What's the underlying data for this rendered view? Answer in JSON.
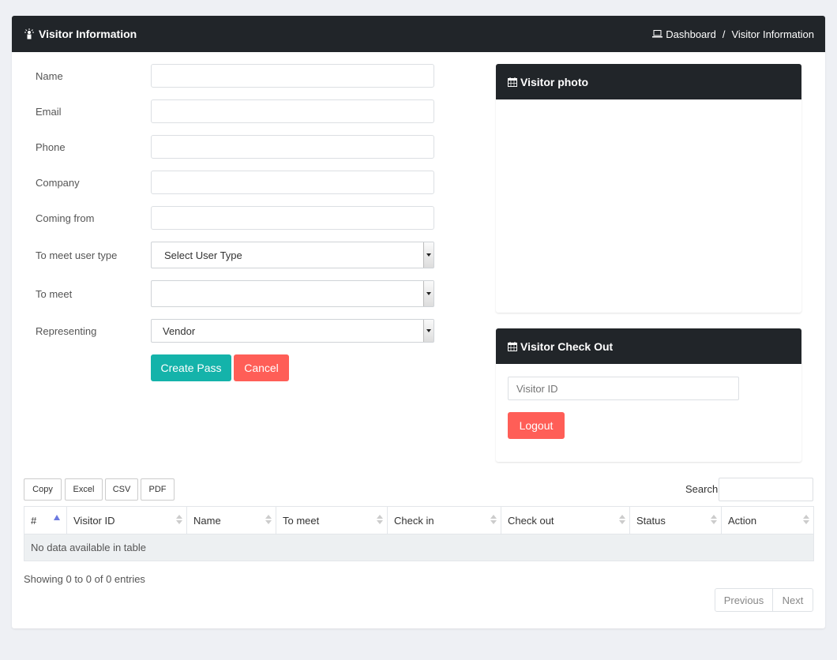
{
  "header": {
    "title": "Visitor Information",
    "breadcrumb": {
      "home": "Dashboard",
      "separator": "/",
      "current": "Visitor Information"
    }
  },
  "form": {
    "name_label": "Name",
    "email_label": "Email",
    "phone_label": "Phone",
    "company_label": "Company",
    "coming_from_label": "Coming from",
    "user_type_label": "To meet user type",
    "user_type_value": "Select User Type",
    "to_meet_label": "To meet",
    "to_meet_value": "",
    "representing_label": "Representing",
    "representing_value": "Vendor",
    "create_label": "Create Pass",
    "cancel_label": "Cancel"
  },
  "photo_panel": {
    "title": "Visitor photo"
  },
  "checkout": {
    "title": "Visitor Check Out",
    "placeholder": "Visitor ID",
    "logout_label": "Logout"
  },
  "table_tools": {
    "buttons": [
      "Copy",
      "Excel",
      "CSV",
      "PDF"
    ],
    "search_label": "Search:"
  },
  "table": {
    "columns": [
      "#",
      "Visitor ID",
      "Name",
      "To meet",
      "Check in",
      "Check out",
      "Status",
      "Action"
    ],
    "empty": "No data available in table",
    "info": "Showing 0 to 0 of 0 entries",
    "prev": "Previous",
    "next": "Next"
  },
  "colors": {
    "header_bg": "#212529",
    "primary": "#14b3aa",
    "danger": "#ff5e57",
    "sort_active": "#6c7ae0"
  }
}
